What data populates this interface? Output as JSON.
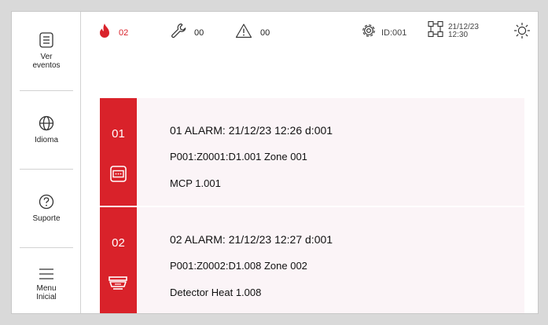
{
  "sidebar": {
    "events_label_1": "Ver",
    "events_label_2": "eventos",
    "language_label": "Idioma",
    "support_label": "Suporte",
    "menu_label_1": "Menu",
    "menu_label_2": "Inicial"
  },
  "status": {
    "fire_count": "02",
    "fault_count": "00",
    "warning_count": "00",
    "device_id": "ID:001",
    "date": "21/12/23",
    "time": "12:30"
  },
  "events": [
    {
      "number": "01",
      "title": "01 ALARM: 21/12/23 12:26 d:001",
      "address": "P001:Z0001:D1.001 Zone 001",
      "device": "MCP 1.001",
      "device_icon": "manual-call-point-icon"
    },
    {
      "number": "02",
      "title": "02 ALARM: 21/12/23 12:27 d:001",
      "address": "P001:Z0002:D1.008 Zone 002",
      "device": "Detector Heat 1.008",
      "device_icon": "heat-detector-icon"
    }
  ],
  "colors": {
    "alarm_red": "#d9222a",
    "card_background": "#fbf4f7"
  }
}
